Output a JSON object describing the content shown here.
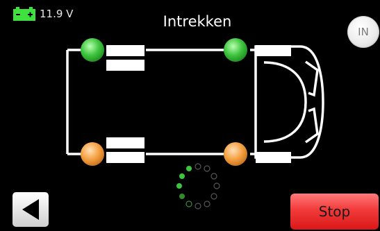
{
  "status": {
    "battery_icon": "battery-icon",
    "voltage": "11.9 V"
  },
  "title": "Intrekken",
  "in_button": {
    "label": "IN"
  },
  "wheels": {
    "front_left": {
      "state": "ok",
      "color": "#3ec43e"
    },
    "front_right": {
      "state": "ok",
      "color": "#3ec43e"
    },
    "rear_left": {
      "state": "warning",
      "color": "#f5a142"
    },
    "rear_right": {
      "state": "warning",
      "color": "#f5a142"
    }
  },
  "spinner": {
    "icon": "loading-spinner-icon",
    "active_color": "#3ec43e",
    "inactive_color": "#4a4a4a"
  },
  "back_button": {
    "icon": "back-arrow-icon"
  },
  "stop_button": {
    "label": "Stop"
  }
}
